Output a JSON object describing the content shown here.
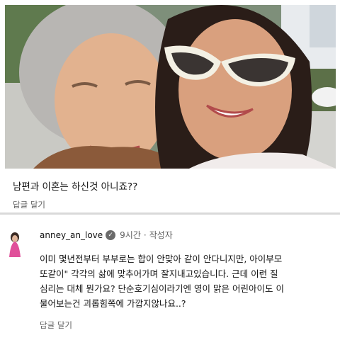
{
  "photo": {
    "description_icon": "selfie-photo"
  },
  "comment1": {
    "text": "남편과 이혼는 하신것 아니죠??",
    "reply_label": "답글 달기"
  },
  "comment2": {
    "username": "anney_an_love",
    "verified_icon": "verified-check-icon",
    "time": "9시간",
    "separator": "·",
    "author_label": "작성자",
    "lines": [
      "이미 몇년전부터 부부로는 합이 안맞아 같이 안다니지만, 아이부모",
      "또같이\" 각각의 삶에 맞추어가며 잘지내고있습니다. 근데 이런 질",
      "심리는 대체 뭔가요? 단순호기심이라기엔 영이 맑은 어린아이도 이",
      "물어보는건 괴롭힘쪽에 가깝지않나요..?"
    ],
    "reply_label": "답글 달기"
  },
  "colors": {
    "text": "#111111",
    "muted": "#606060",
    "divider": "#d9d9d9"
  }
}
